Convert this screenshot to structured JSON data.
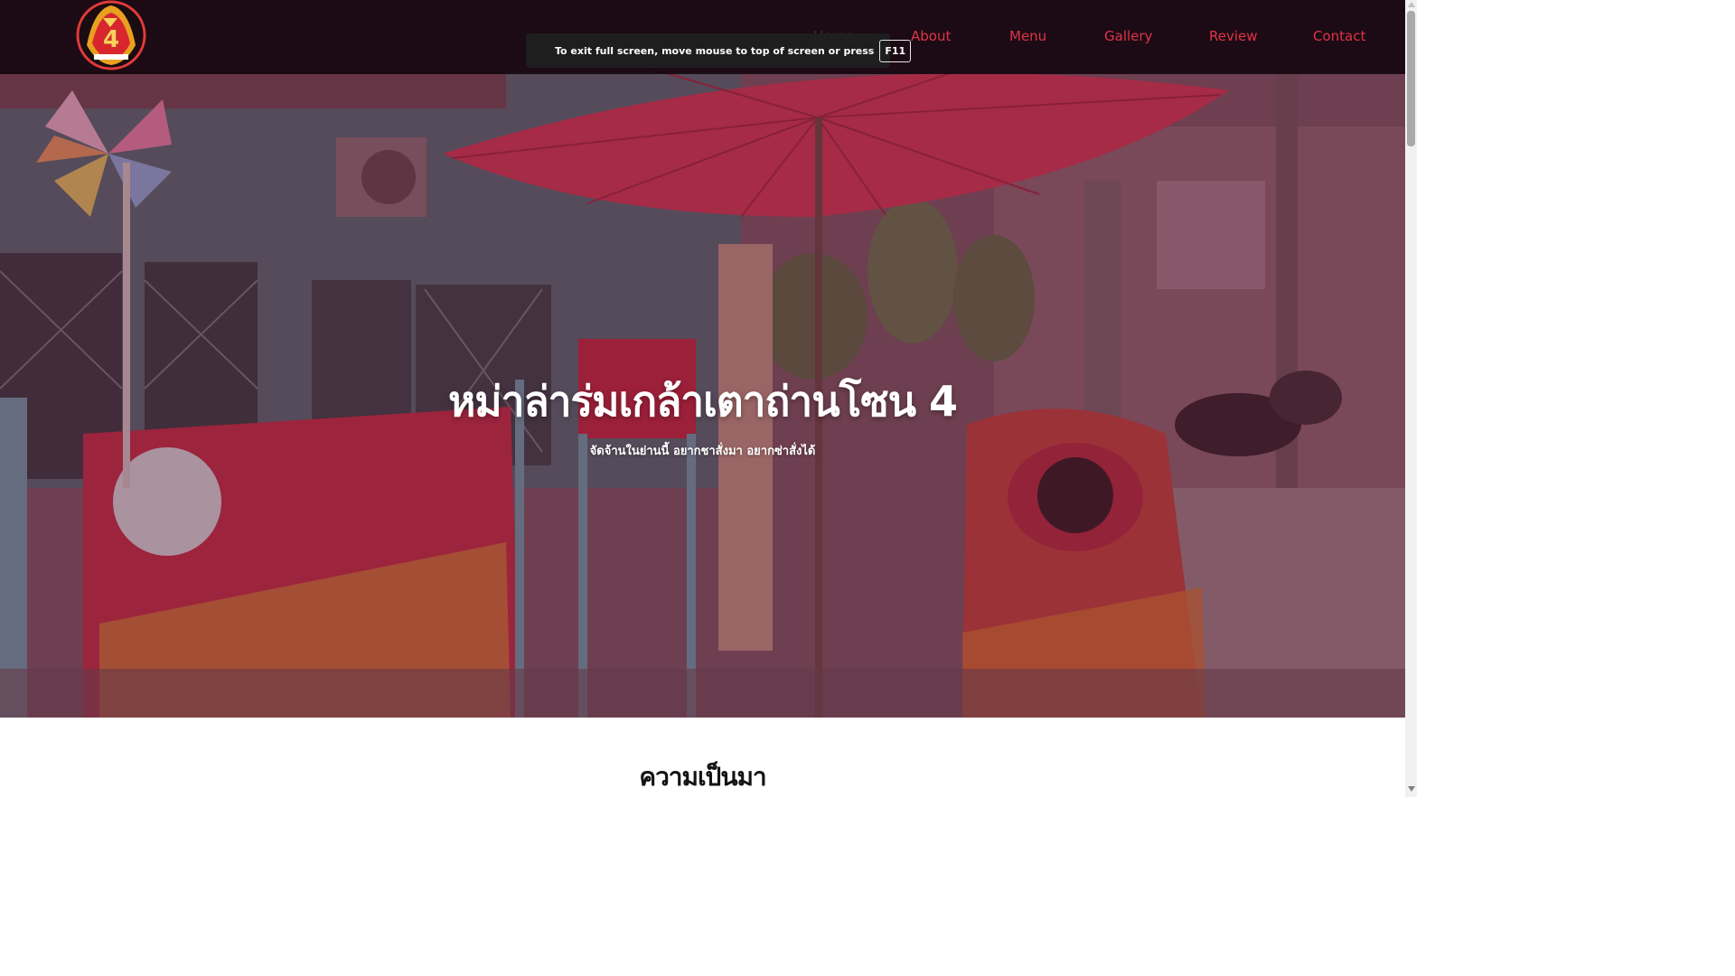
{
  "nav": {
    "items": [
      {
        "label": "Home"
      },
      {
        "label": "About"
      },
      {
        "label": "Menu"
      },
      {
        "label": "Gallery"
      },
      {
        "label": "Review"
      },
      {
        "label": "Contact"
      }
    ],
    "logo_icon": "restaurant-logo-icon",
    "link_color": "#e0334a"
  },
  "fullscreen_notice": {
    "text": "To exit full screen, move mouse to top of screen or press",
    "key": "F11"
  },
  "hero": {
    "title": "หม่าล่าร่มเกล้าเตาถ่านโซน 4",
    "subtitle": "จัดจ้านในย่านนี้ อยากชาสั่งมา อยากซ่าสั่งได้"
  },
  "section": {
    "heading": "ความเป็นมา"
  }
}
